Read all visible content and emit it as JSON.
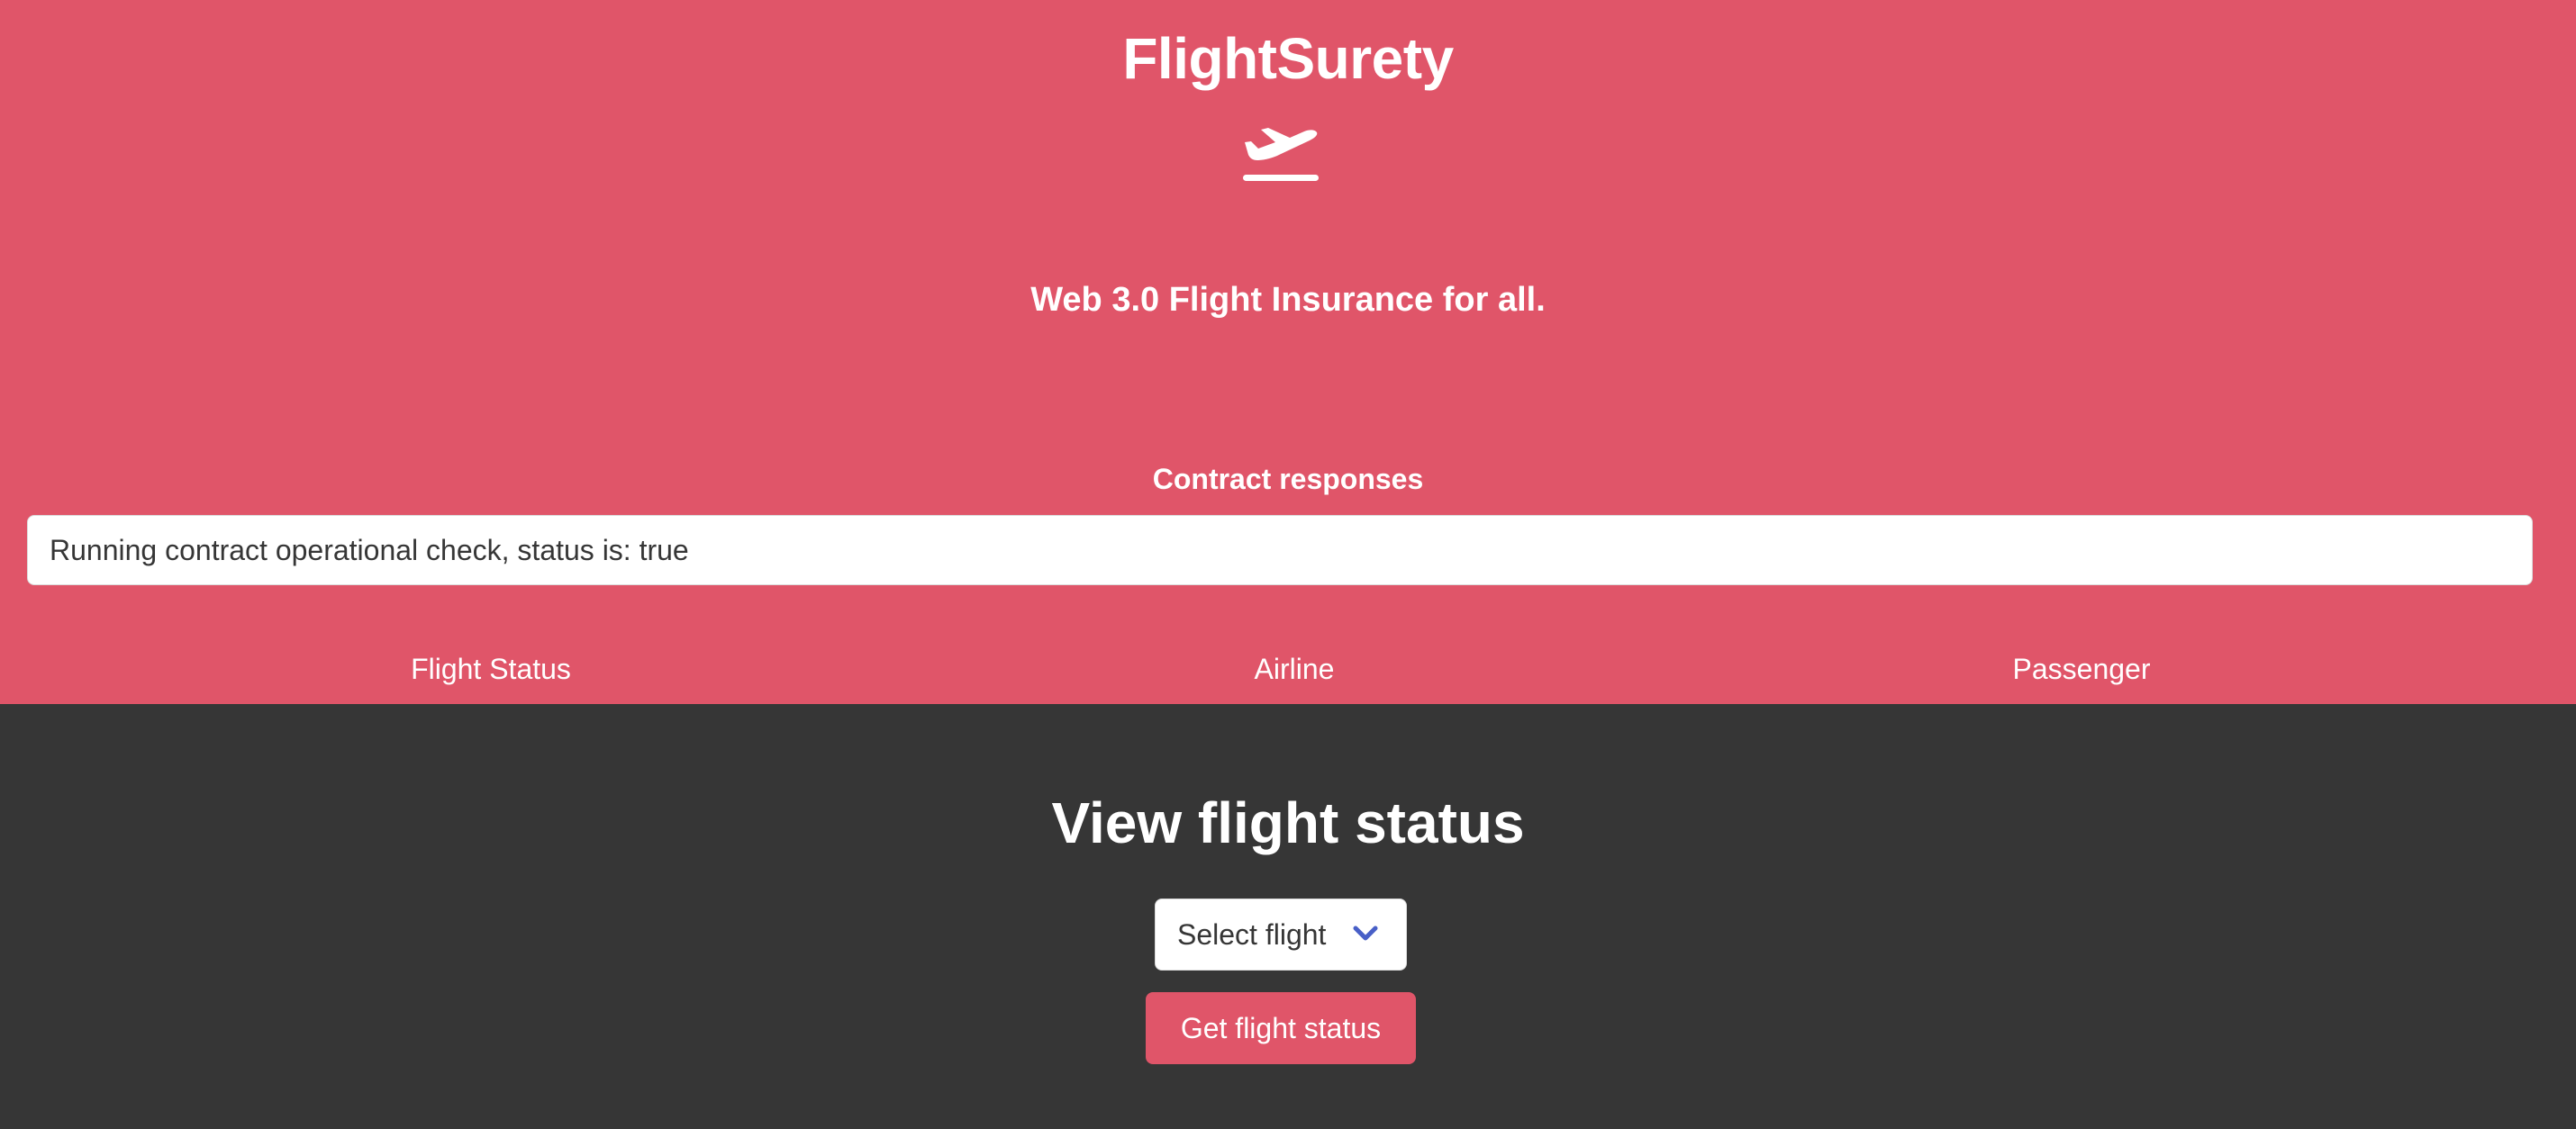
{
  "app": {
    "title": "FlightSurety",
    "logo_icon": "plane-departure-icon",
    "tagline": "Web 3.0 Flight Insurance for all."
  },
  "responses": {
    "title": "Contract responses",
    "message": "Running contract operational check, status is: true"
  },
  "tabs": [
    {
      "label": "Flight Status"
    },
    {
      "label": "Airline"
    },
    {
      "label": "Passenger"
    }
  ],
  "flight_status": {
    "title": "View flight status",
    "select_value": "Select flight",
    "select_icon": "chevron-down-icon",
    "button_label": "Get flight status"
  },
  "colors": {
    "accent": "#e05569",
    "dark_bg": "#363636",
    "chevron": "#485fc7"
  }
}
